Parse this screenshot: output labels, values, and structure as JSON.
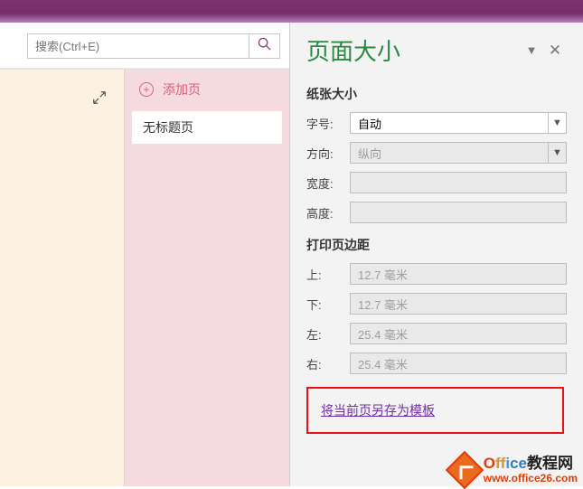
{
  "search": {
    "placeholder": "搜索(Ctrl+E)"
  },
  "pages": {
    "addLabel": "添加页",
    "items": [
      "无标题页"
    ]
  },
  "panel": {
    "title": "页面大小",
    "paperSizeHeader": "纸张大小",
    "fields": {
      "sizeLabel": "字号:",
      "sizeValue": "自动",
      "orientLabel": "方向:",
      "orientValue": "纵向",
      "widthLabel": "宽度:",
      "widthValue": "",
      "heightLabel": "高度:",
      "heightValue": ""
    },
    "marginHeader": "打印页边距",
    "margins": {
      "topLabel": "上:",
      "topValue": "12.7 毫米",
      "bottomLabel": "下:",
      "bottomValue": "12.7 毫米",
      "leftLabel": "左:",
      "leftValue": "25.4 毫米",
      "rightLabel": "右:",
      "rightValue": "25.4 毫米"
    },
    "saveTemplateLink": "将当前页另存为模板"
  },
  "watermark": {
    "brand": "Office",
    "brandCn": "教程网",
    "url": "www.office26.com"
  }
}
